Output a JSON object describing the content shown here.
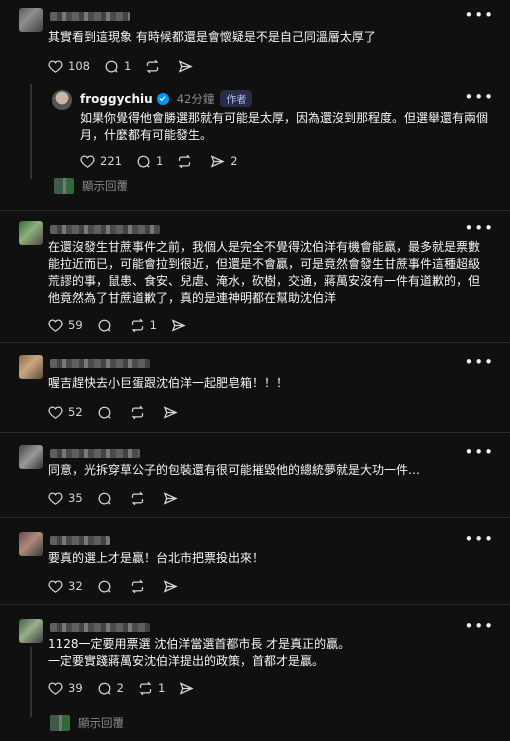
{
  "post1": {
    "text": "其實看到這現象 有時候都還是會懷疑是不是自己同溫層太厚了",
    "likes": "108",
    "comments": "1"
  },
  "reply1": {
    "author": "froggychiu",
    "time": "42分鐘",
    "tag": "作者",
    "text": "如果你覺得他會勝選那就有可能是太厚，因為還沒到那程度。但選舉還有兩個月，什麼都有可能發生。",
    "likes": "221",
    "comments": "1",
    "shares": "2",
    "hidden_label": "顯示回覆"
  },
  "post2": {
    "text": "在還沒發生甘蔗事件之前，我個人是完全不覺得沈伯洋有機會能贏，最多就是票數能拉近而已，可能會拉到很近，但還是不會贏，可是竟然會發生甘蔗事件這種超級荒謬的事，鼠患、食安、兒虐、淹水，砍樹，交通，蔣萬安沒有一件有道歉的，但他竟然為了甘蔗道歉了，真的是連神明都在幫助沈伯洋",
    "likes": "59",
    "reposts": "1"
  },
  "post3": {
    "text": "喔吉趕快去小巨蛋跟沈伯洋一起肥皂箱！！！",
    "likes": "52"
  },
  "post4": {
    "text": "同意，光拆穿草公子的包裝還有很可能摧毀他的總統夢就是大功一件…",
    "likes": "35"
  },
  "post5": {
    "text": "要真的選上才是贏！台北市把票投出來！",
    "likes": "32"
  },
  "post6": {
    "text": "1128一定要用票選 沈伯洋當選首都市長 才是真正的贏。\n一定要實踐蔣萬安沈伯洋提出的政策，首都才是贏。",
    "likes": "39",
    "comments": "2",
    "reposts": "1",
    "hidden_label": "顯示回覆"
  },
  "icons": [
    "heart-icon",
    "comment-icon",
    "repost-icon",
    "share-icon",
    "more-icon",
    "verified-icon"
  ],
  "colors": {
    "background": "#101010",
    "text": "#f3f5f7",
    "muted": "#8a8a8a",
    "verified": "#0095f6",
    "author_tag_bg": "#2a2d4a"
  }
}
